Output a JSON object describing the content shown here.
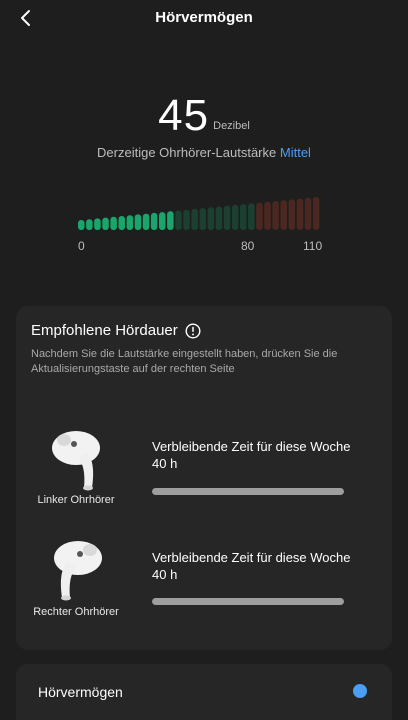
{
  "header": {
    "title": "Hörvermögen",
    "back_icon": "chevron-left-icon"
  },
  "volume": {
    "value": "45",
    "unit": "Dezibel",
    "level_label": "Derzeitige Ohrhörer-Lautstärke",
    "level_value": "Mittel",
    "level_color": "#4a9ff5"
  },
  "meter": {
    "min": 0,
    "max": 110,
    "current": 45,
    "scale_labels": [
      "0",
      "80",
      "110"
    ],
    "colors": {
      "active_green": "#1aa56c",
      "inactive_green": "#1b3f31",
      "inactive_red": "#4a2720"
    }
  },
  "recommended": {
    "title": "Empfohlene Hördauer",
    "info_icon": "info-circle-icon",
    "description": "Nachdem Sie die Lautstärke eingestellt haben, drücken Sie die Aktualisierungstaste auf der rechten Seite",
    "buds": [
      {
        "label": "Linker Ohrhörer",
        "time_text": "Verbleibende Zeit für diese Woche 40 h",
        "remaining_fraction": 1.0
      },
      {
        "label": "Rechter Ohrhörer",
        "time_text": "Verbleibende Zeit für diese Woche 40 h",
        "remaining_fraction": 1.0
      }
    ]
  },
  "bottom": {
    "label": "Hörvermögen",
    "toggle_color": "#4a9ff5"
  }
}
